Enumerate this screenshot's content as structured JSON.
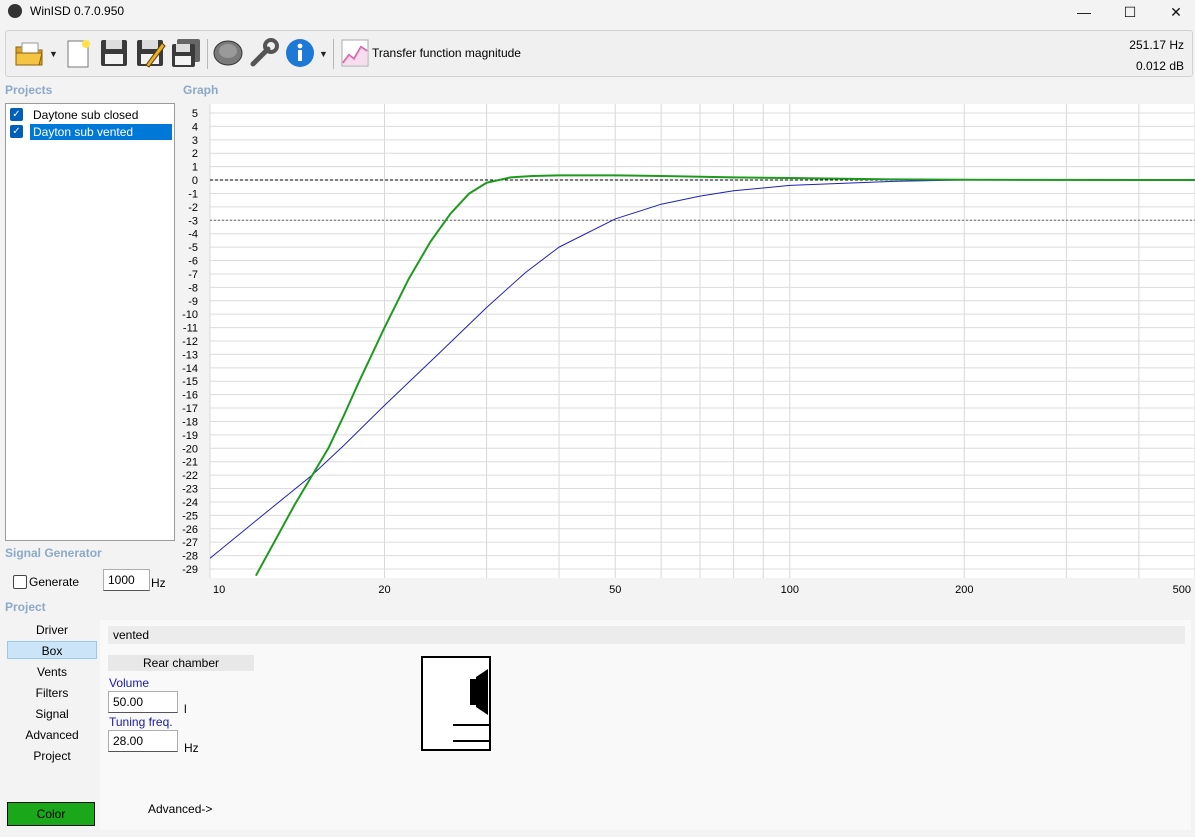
{
  "window": {
    "title": "WinISD 0.7.0.950",
    "minimize": "—",
    "maximize": "☐",
    "close": "✕"
  },
  "toolbar": {
    "icons": [
      "open-folder-icon",
      "new-project-icon",
      "save-icon",
      "save-as-icon",
      "save-all-icon",
      "driver-icon",
      "tools-icon",
      "info-icon",
      "graph-icon"
    ],
    "graph_label": "Transfer function magnitude",
    "readout_freq": "251.17 Hz",
    "readout_level": "0.012 dB"
  },
  "projects": {
    "heading": "Projects",
    "items": [
      {
        "label": "Daytone sub closed",
        "checked": true,
        "selected": false
      },
      {
        "label": "Dayton sub vented",
        "checked": true,
        "selected": true
      }
    ]
  },
  "graph": {
    "heading": "Graph"
  },
  "chart_data": {
    "type": "line",
    "title": "",
    "xlabel": "",
    "ylabel": "",
    "x_scale": "log",
    "xlim": [
      10,
      500
    ],
    "ylim": [
      -29,
      5
    ],
    "x_ticks": [
      "10",
      "20",
      "50",
      "100",
      "200",
      "500"
    ],
    "y_ticks": [
      "5",
      "4",
      "3",
      "2",
      "1",
      "0",
      "-1",
      "-2",
      "-3",
      "-4",
      "-5",
      "-6",
      "-7",
      "-8",
      "-9",
      "-10",
      "-11",
      "-12",
      "-13",
      "-14",
      "-15",
      "-16",
      "-17",
      "-18",
      "-19",
      "-20",
      "-21",
      "-22",
      "-23",
      "-24",
      "-25",
      "-26",
      "-27",
      "-28",
      "-29"
    ],
    "reference_lines_db": [
      0,
      -3
    ],
    "grid": true,
    "series": [
      {
        "color": "#2020b8",
        "x": [
          10,
          12,
          15,
          17,
          20,
          25,
          30,
          35,
          40,
          50,
          60,
          70,
          80,
          100,
          150,
          200
        ],
        "y": [
          -28.2,
          -25.4,
          -22.0,
          -19.8,
          -16.8,
          -12.8,
          -9.5,
          -6.9,
          -5.0,
          -2.9,
          -1.8,
          -1.2,
          -0.8,
          -0.4,
          -0.1,
          0
        ]
      },
      {
        "color": "#1e9a1e",
        "x": [
          12,
          14,
          16,
          17,
          18,
          20,
          22,
          24,
          26,
          28,
          30,
          33,
          36,
          40,
          50,
          60,
          80,
          100,
          150,
          200,
          500
        ],
        "y": [
          -29.5,
          -24.2,
          -20.0,
          -17.6,
          -15.2,
          -11.0,
          -7.4,
          -4.6,
          -2.5,
          -1.0,
          -0.2,
          0.2,
          0.3,
          0.35,
          0.35,
          0.3,
          0.2,
          0.15,
          0.05,
          0.02,
          0
        ]
      }
    ]
  },
  "signal_generator": {
    "heading": "Signal Generator",
    "generate_label": "Generate",
    "frequency": "1000",
    "unit": "Hz"
  },
  "project": {
    "heading": "Project",
    "nav": [
      "Driver",
      "Box",
      "Vents",
      "Filters",
      "Signal",
      "Advanced",
      "Project"
    ],
    "active": "Box",
    "color_label": "Color",
    "color": "#1aa81a"
  },
  "box_panel": {
    "box_type": "vented",
    "chamber": "Rear chamber",
    "volume_label": "Volume",
    "volume_value": "50.00",
    "volume_unit": "l",
    "tuning_label": "Tuning freq.",
    "tuning_value": "28.00",
    "tuning_unit": "Hz",
    "advanced_link": "Advanced->"
  }
}
